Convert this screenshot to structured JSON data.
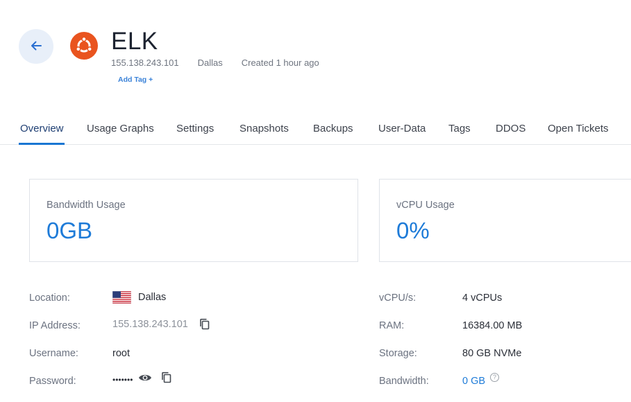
{
  "header": {
    "title": "ELK",
    "ip": "155.138.243.101",
    "location": "Dallas",
    "created": "Created 1 hour ago",
    "add_tag": "Add Tag +",
    "os_icon": "ubuntu-icon"
  },
  "tabs": [
    {
      "label": "Overview",
      "active": true
    },
    {
      "label": "Usage Graphs"
    },
    {
      "label": "Settings"
    },
    {
      "label": "Snapshots"
    },
    {
      "label": "Backups"
    },
    {
      "label": "User-Data"
    },
    {
      "label": "Tags"
    },
    {
      "label": "DDOS"
    },
    {
      "label": "Open Tickets"
    }
  ],
  "cards": {
    "bandwidth": {
      "label": "Bandwidth Usage",
      "value": "0GB"
    },
    "vcpu": {
      "label": "vCPU Usage",
      "value": "0%"
    }
  },
  "details_left": {
    "location": {
      "label": "Location:",
      "value": "Dallas",
      "flag": "us-flag-icon"
    },
    "ip": {
      "label": "IP Address:",
      "value": "155.138.243.101"
    },
    "username": {
      "label": "Username:",
      "value": "root"
    },
    "password": {
      "label": "Password:",
      "value": "•••••••"
    }
  },
  "details_right": {
    "vcpus": {
      "label": "vCPU/s:",
      "value": "4 vCPUs"
    },
    "ram": {
      "label": "RAM:",
      "value": "16384.00 MB"
    },
    "storage": {
      "label": "Storage:",
      "value": "80 GB NVMe"
    },
    "bandwidth": {
      "label": "Bandwidth:",
      "value": "0 GB"
    }
  },
  "colors": {
    "accent": "#1e7bd8",
    "ubuntu_orange": "#e9541f",
    "back_button_bg": "#e8eff9"
  }
}
